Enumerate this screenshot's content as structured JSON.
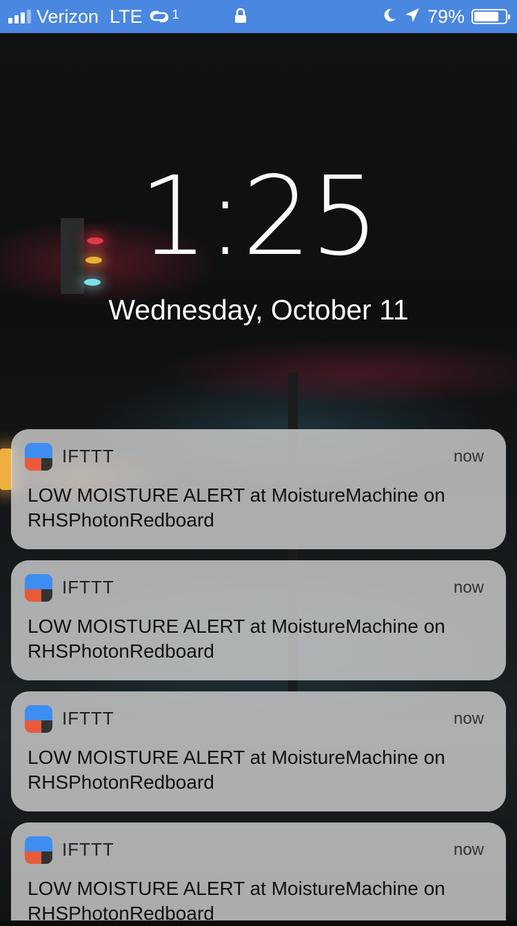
{
  "status_bar": {
    "carrier": "Verizon",
    "network": "LTE",
    "hotspot_badge": "1",
    "battery_percent": "79%",
    "battery_level": 0.79,
    "bar_color": "#4a87e0",
    "icons": [
      "signal-icon",
      "link-icon",
      "lock-icon",
      "moon-icon",
      "location-arrow-icon",
      "battery-icon"
    ]
  },
  "lock_screen": {
    "time": "1:25",
    "date": "Wednesday, October 11"
  },
  "notifications": [
    {
      "app": "IFTTT",
      "time": "now",
      "message": "LOW MOISTURE ALERT at MoistureMachine on RHSPhotonRedboard"
    },
    {
      "app": "IFTTT",
      "time": "now",
      "message": "LOW MOISTURE ALERT at MoistureMachine on RHSPhotonRedboard"
    },
    {
      "app": "IFTTT",
      "time": "now",
      "message": "LOW MOISTURE ALERT at MoistureMachine on RHSPhotonRedboard"
    },
    {
      "app": "IFTTT",
      "time": "now",
      "message": "LOW MOISTURE ALERT at MoistureMachine on RHSPhotonRedboard"
    }
  ]
}
